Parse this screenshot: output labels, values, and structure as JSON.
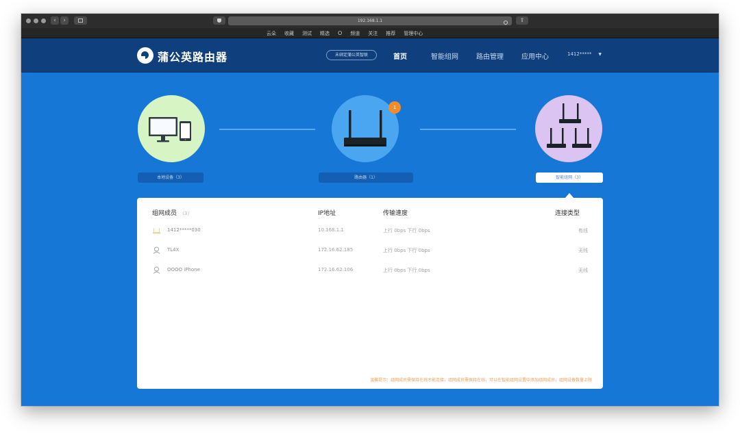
{
  "browser": {
    "url": "192.168.1.1",
    "favorites": [
      "云朵",
      "收藏",
      "测试",
      "精选",
      "O",
      "频道",
      "关注",
      "推荐",
      "管理中心"
    ]
  },
  "header": {
    "brand": "蒲公英路由器",
    "cloud_button": "未绑定蒲公英智联",
    "nav": [
      "首页",
      "智能组网",
      "路由管理",
      "应用中心"
    ],
    "user": "1412*****"
  },
  "topology": {
    "local_label": "本地设备（3）",
    "router_label": "路由器（1）",
    "network_label": "智能组网（3）",
    "badge": "1"
  },
  "table": {
    "headers": {
      "member": "组网成员",
      "member_count": "（3）",
      "ip": "IP地址",
      "speed": "传输速度",
      "conn": "连接类型"
    },
    "rows": [
      {
        "name": "1412*****030",
        "ip": "10.168.1.1",
        "speed": "上行  0bps    下行  0bps",
        "conn": "有线"
      },
      {
        "name": "TL4X",
        "ip": "172.16.62.185",
        "speed": "上行  0bps    下行  0bps",
        "conn": "无线"
      },
      {
        "name": "OOOO iPhone",
        "ip": "172.16.62.106",
        "speed": "上行  0bps    下行  0bps",
        "conn": "无线"
      }
    ],
    "notice": "温馨提示：组网成员需保持在线才能连接，组网成员需保持在线，可以在智能组网设置中添加组网成员，组网设备数量上限"
  },
  "colors": {
    "page_bg": "#1677d6",
    "header_bg": "#0f3f7c",
    "local_circle": "#d7f5c4",
    "router_circle": "#4aa6f0",
    "network_circle": "#dcc4f2",
    "badge": "#f28b2c"
  }
}
